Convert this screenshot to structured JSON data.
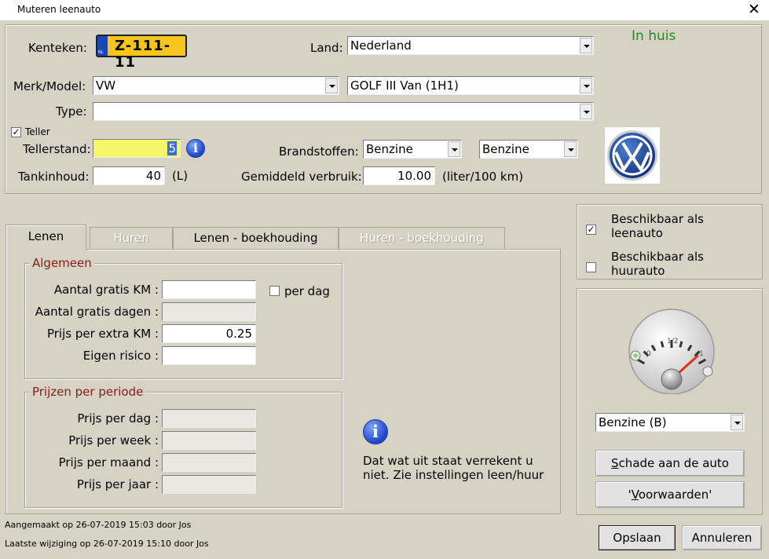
{
  "window": {
    "title": "Muteren leenauto",
    "close_glyph": "✕"
  },
  "vehicle": {
    "kenteken_label": "Kenteken:",
    "plate_text": "Z-111-11",
    "plate_country": "NL",
    "land_label": "Land:",
    "land_value": "Nederland",
    "status_text": "In huis",
    "merk_model_label": "Merk/Model:",
    "merk_value": "VW",
    "model_value": "GOLF III Van (1H1)",
    "type_label": "Type:",
    "type_value": "",
    "teller_checkbox_label": "Teller",
    "teller_checked": true,
    "tellerstand_label": "Tellerstand:",
    "tellerstand_value": "5",
    "brandstoffen_label": "Brandstoffen:",
    "brandstof_1": "Benzine",
    "brandstof_2": "Benzine",
    "tankinhoud_label": "Tankinhoud:",
    "tankinhoud_value": "40",
    "tankinhoud_unit": "(L)",
    "verbruik_label": "Gemiddeld verbruik:",
    "verbruik_value": "10.00",
    "verbruik_unit": "(liter/100 km)",
    "brand_logo_icon": "vw-logo-icon"
  },
  "tabs": [
    {
      "label": "Lenen",
      "active": true,
      "enabled": true
    },
    {
      "label": "Huren",
      "active": false,
      "enabled": false
    },
    {
      "label": "Lenen - boekhouding",
      "active": false,
      "enabled": true
    },
    {
      "label": "Huren - boekhouding",
      "active": false,
      "enabled": false
    }
  ],
  "algemeen": {
    "legend": "Algemeen",
    "gratis_km_label": "Aantal gratis KM :",
    "gratis_km_value": "",
    "per_dag_label": "per dag",
    "per_dag_checked": false,
    "gratis_dagen_label": "Aantal gratis dagen :",
    "gratis_dagen_value": "",
    "prijs_extra_km_label": "Prijs per extra KM :",
    "prijs_extra_km_value": "0.25",
    "eigen_risico_label": "Eigen risico :",
    "eigen_risico_value": ""
  },
  "prijzen": {
    "legend": "Prijzen per periode",
    "dag_label": "Prijs per dag :",
    "week_label": "Prijs per week :",
    "maand_label": "Prijs per maand :",
    "jaar_label": "Prijs per jaar :",
    "dag_value": "",
    "week_value": "",
    "maand_value": "",
    "jaar_value": ""
  },
  "info_note": {
    "line1": "Dat wat uit staat verrekent u",
    "line2": "niet. Zie instellingen leen/huur"
  },
  "beschikbaar": {
    "leen_line1": "Beschikbaar als",
    "leen_line2": "leenauto",
    "leen_checked": true,
    "huur_line1": "Beschikbaar als",
    "huur_line2": "huurauto",
    "huur_checked": false
  },
  "fuel": {
    "gauge_empty_label": "0",
    "gauge_half_label": "1/2",
    "gauge_full_label": "1",
    "gauge_level": 0.9,
    "type_value": "Benzine (B)",
    "schade_button_first": "S",
    "schade_button_rest": "chade aan de auto",
    "voorwaarden_button_pre": "'",
    "voorwaarden_button_ul": "V",
    "voorwaarden_button_rest": "oorwaarden'"
  },
  "footer": {
    "created_text": "Aangemaakt op 26-07-2019 15:03 door Jos",
    "modified_text": "Laatste wijziging op 26-07-2019 15:10 door Jos",
    "save_button": "Opslaan",
    "cancel_button": "Annuleren"
  },
  "colors": {
    "form_bg": "#d6d3c5",
    "status_green": "#228b22",
    "legend_red": "#8a1b1b",
    "highlight_yellow": "#f5f76a",
    "plate_yellow": "#f6c41a"
  }
}
